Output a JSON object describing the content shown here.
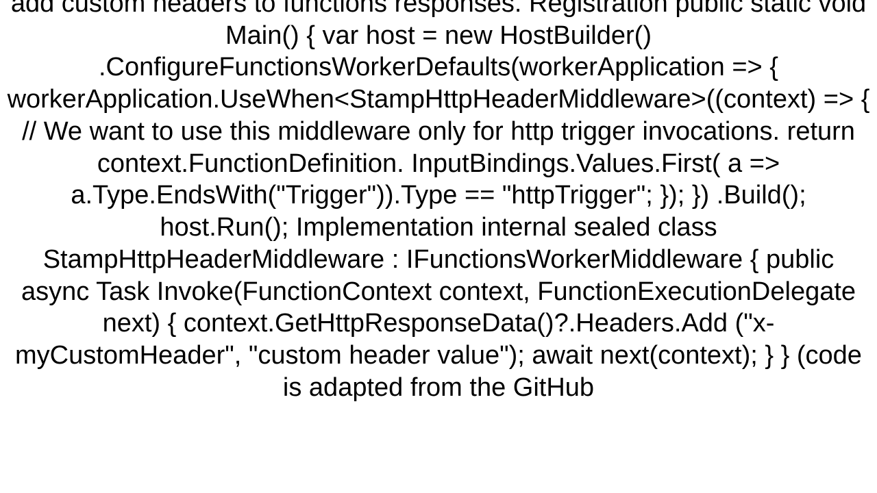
{
  "document": {
    "text": "add custom headers to functions responses. Registration public static void Main() {   var host = new HostBuilder()     .ConfigureFunctionsWorkerDefaults(workerApplication =>     {       workerApplication.UseWhen<StampHttpHeaderMiddleware>((context) =>       {           // We want to use this middleware only for http trigger invocations.          return context.FunctionDefinition.                   InputBindings.Values.First(             a => a.Type.EndsWith(\"Trigger\")).Type == \"httpTrigger\";        });      })     .Build();    host.Run();  Implementation internal sealed class StampHttpHeaderMiddleware : IFunctionsWorkerMiddleware {     public async Task Invoke(FunctionContext context, FunctionExecutionDelegate next)     {        context.GetHttpResponseData()?.Headers.Add            (\"x-myCustomHeader\", \"custom header value\");        await next(context);     } }  (code is adapted from the GitHub"
  }
}
